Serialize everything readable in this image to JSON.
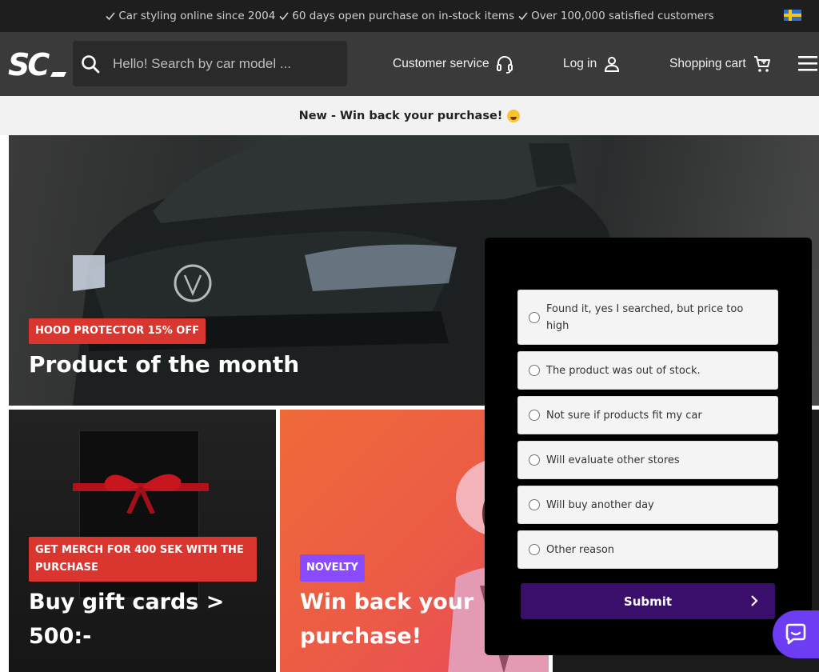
{
  "usp": {
    "items": [
      "Car styling online since 2004",
      "60 days open purchase on in-stock items",
      "Over 100,000 satisfied customers"
    ],
    "flag_icon": "sweden-flag-icon"
  },
  "header": {
    "logo_text": "SC",
    "search_placeholder": "Hello! Search by car model ...",
    "customer_service": "Customer service",
    "login": "Log in",
    "cart": "Shopping cart"
  },
  "announcement": {
    "text": "New - Win back your purchase!",
    "emoji_icon": "star-struck-emoji-icon"
  },
  "hero": {
    "badge": "HOOD PROTECTOR 15% OFF",
    "title": "Product of the month"
  },
  "tiles": {
    "gift": {
      "badge": "GET MERCH FOR 400 SEK WITH THE PURCHASE",
      "title": "Buy gift cards > 500:-"
    },
    "win": {
      "badge": "NOVELTY",
      "title": "Win back your purchase!"
    }
  },
  "survey": {
    "options": [
      "Found it, yes I searched, but price too high",
      "The product was out of stock.",
      "Not sure if products fit my car",
      "Will evaluate other stores",
      "Will buy another day",
      "Other reason"
    ],
    "submit": "Submit"
  },
  "colors": {
    "accent_red": "#d9362f",
    "accent_purple": "#8a4bff",
    "submit_bg": "#3a0e6b",
    "chat_bg": "#6c3df2"
  }
}
